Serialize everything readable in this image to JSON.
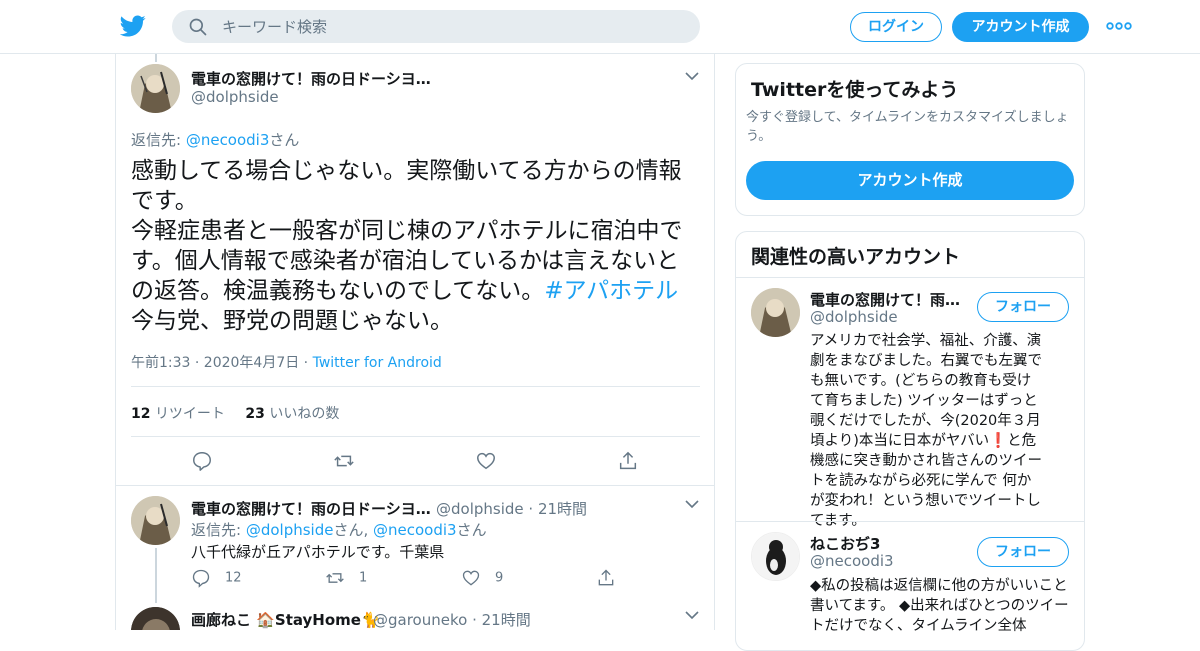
{
  "header": {
    "search_placeholder": "キーワード検索",
    "login_label": "ログイン",
    "signup_label": "アカウント作成"
  },
  "main_tweet": {
    "name": "電車の窓開けて！雨の日ドーシヨ…",
    "handle": "@dolphside",
    "reply_prefix": "返信先: ",
    "reply_to": "@necoodi3",
    "reply_suffix": "さん",
    "text_lines": [
      "感動してる場合じゃない。実際働いてる方からの情報",
      "です。",
      "今軽症患者と一般客が同じ棟のアパホテルに宿泊中で",
      "す。個人情報で感染者が宿泊しているかは言えないと",
      "の返答。検温義務もないのでしてない。",
      "今与党、野党の問題じゃない。"
    ],
    "hashtag": "#アパホテル",
    "timestamp": "午前1:33 · 2020年4月7日",
    "separator": " · ",
    "source": "Twitter for Android",
    "retweet_count": "12",
    "retweet_label": "リツイート",
    "like_count": "23",
    "like_label": "いいねの数"
  },
  "replies": [
    {
      "name": "電車の窓開けて！雨の日ドーシヨ…",
      "handle": "@dolphside",
      "time": "21時間",
      "reply_prefix": "返信先: ",
      "reply_to_1": "@dolphside",
      "reply_mid": "さん, ",
      "reply_to_2": "@necoodi3",
      "reply_suffix": "さん",
      "text": "八千代緑が丘アパホテルです。千葉県",
      "reply_count": "12",
      "retweet_count": "1",
      "like_count": "9"
    },
    {
      "name": "画廊ねこ 🏠StayHome🐈",
      "handle": "@garouneko",
      "time": "21時間"
    }
  ],
  "signup_card": {
    "title": "Twitterを使ってみよう",
    "subtitle": "今すぐ登録して、タイムラインをカスタマイズしましょう。",
    "button_label": "アカウント作成"
  },
  "related_card": {
    "title": "関連性の高いアカウント",
    "accounts": [
      {
        "name": "電車の窓開けて！雨…",
        "handle": "@dolphside",
        "follow_label": "フォロー",
        "bio": "アメリカで社会学、福祉、介護、演劇をまなびました。右翼でも左翼でも無いです。(どちらの教育も受けて育ちました) ツイッターはずっと覗くだけでしたが、今(2020年３月頃より)本当に日本がヤバい❗と危機感に突き動かされ皆さんのツイートを読みながら必死に学んで 何かが変われ！という想いでツイートしてます。"
      },
      {
        "name": "ねこおぢ3",
        "handle": "@necoodi3",
        "follow_label": "フォロー",
        "bio": "◆私の投稿は返信欄に他の方がいいこと書いてます。 ◆出来ればひとつのツイートだけでなく、タイムライン全体"
      }
    ]
  },
  "colors": {
    "accent": "#1da1f2",
    "secondary_text": "#657786",
    "border": "#e1e8ed"
  }
}
